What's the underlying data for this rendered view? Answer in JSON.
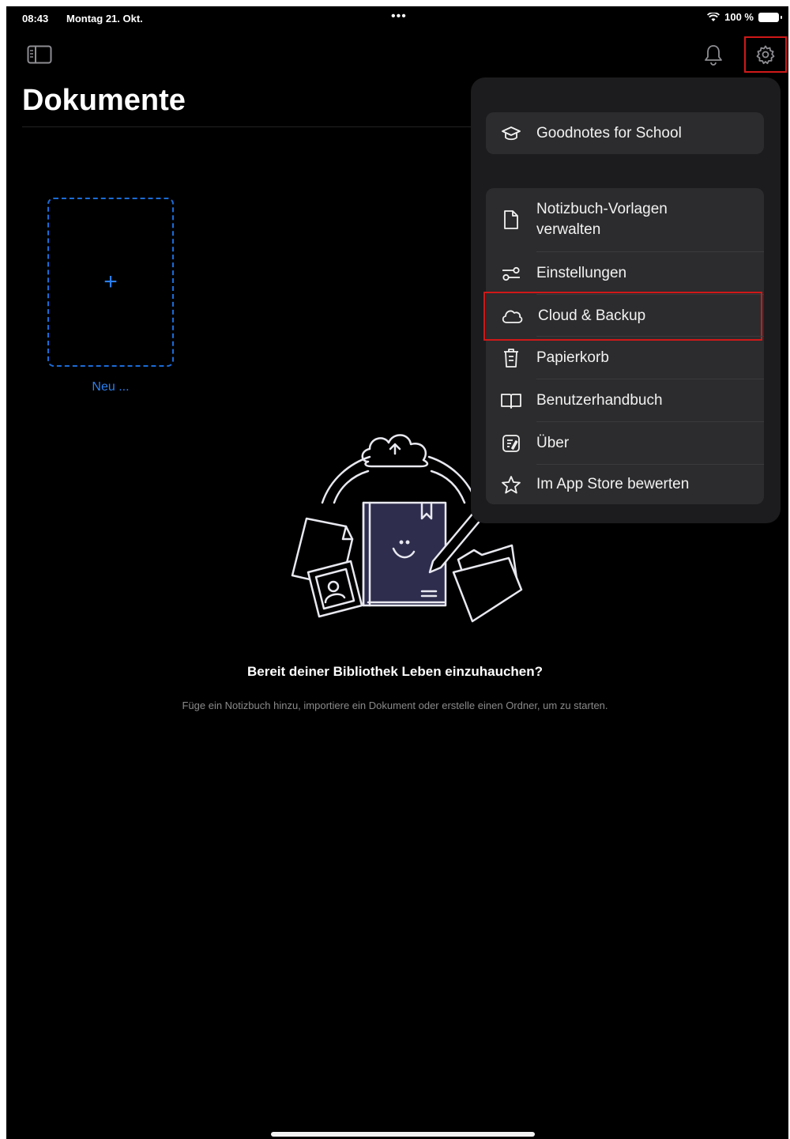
{
  "status_bar": {
    "time": "08:43",
    "date": "Montag 21. Okt.",
    "multitask_dots": "•••",
    "battery": "100 %"
  },
  "page": {
    "title": "Dokumente",
    "new_label": "Neu ...",
    "new_plus": "+",
    "empty_title": "Bereit deiner Bibliothek Leben einzuhauchen?",
    "empty_subtitle": "Füge ein Notizbuch hinzu, importiere ein Dokument oder erstelle einen Ordner, um zu starten."
  },
  "menu": {
    "school": "Goodnotes for School",
    "items": [
      {
        "label": "Notizbuch-Vorlagen verwalten",
        "icon": "document-icon"
      },
      {
        "label": "Einstellungen",
        "icon": "sliders-icon"
      },
      {
        "label": "Cloud & Backup",
        "icon": "cloud-icon"
      },
      {
        "label": "Papierkorb",
        "icon": "trash-icon"
      },
      {
        "label": "Benutzerhandbuch",
        "icon": "book-icon"
      },
      {
        "label": "Über",
        "icon": "info-doc-icon"
      },
      {
        "label": "Im App Store bewerten",
        "icon": "star-icon"
      }
    ]
  },
  "colors": {
    "accent": "#2b7ff0",
    "highlight": "#d01818",
    "background": "#000000",
    "popover": "#1c1c1e"
  }
}
